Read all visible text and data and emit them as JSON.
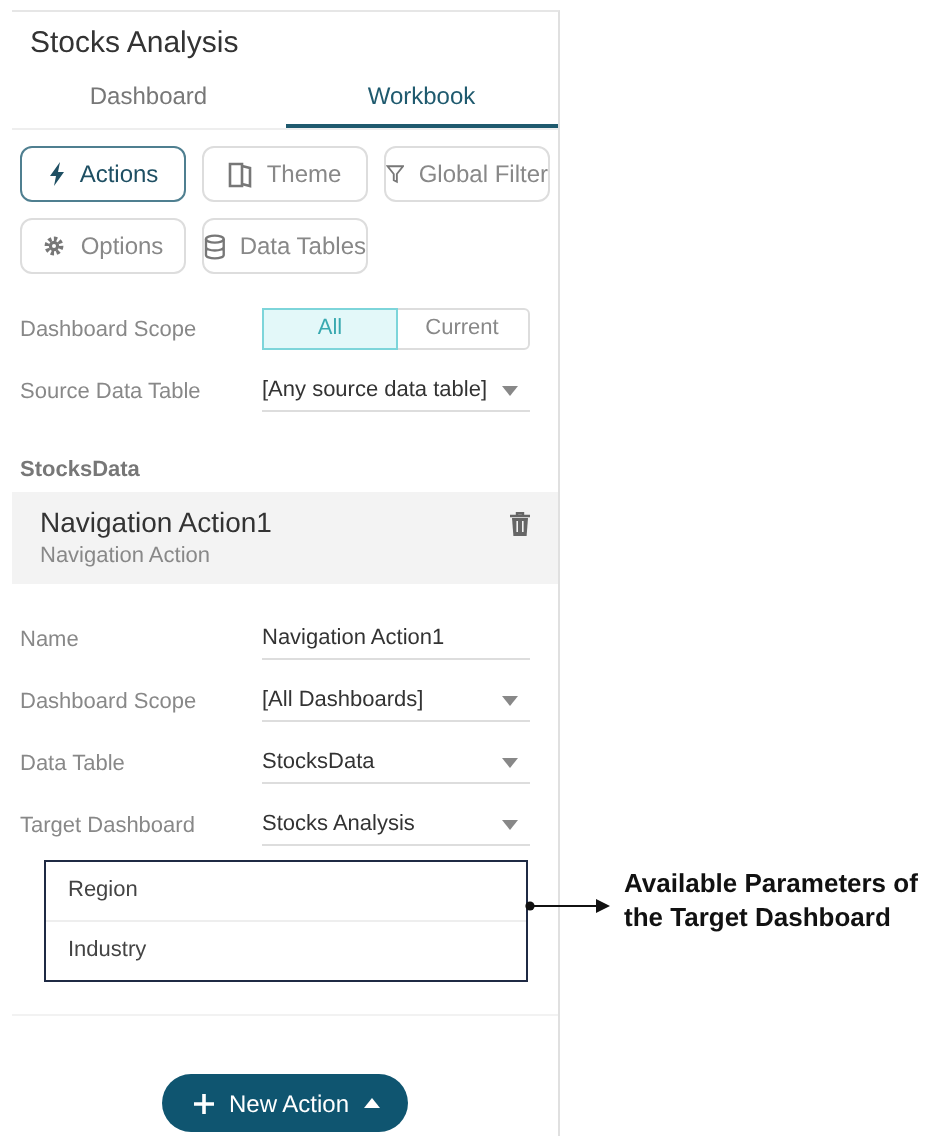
{
  "panel": {
    "title": "Stocks Analysis",
    "tabs": [
      {
        "label": "Dashboard",
        "selected": false
      },
      {
        "label": "Workbook",
        "selected": true
      }
    ],
    "tool_buttons": [
      {
        "label": "Actions",
        "selected": true
      },
      {
        "label": "Theme",
        "selected": false
      },
      {
        "label": "Global Filter",
        "selected": false
      },
      {
        "label": "Options",
        "selected": false
      },
      {
        "label": "Data Tables",
        "selected": false
      }
    ],
    "dashboard_scope": {
      "label": "Dashboard Scope",
      "options": [
        {
          "label": "All",
          "selected": true
        },
        {
          "label": "Current",
          "selected": false
        }
      ]
    },
    "source_data_table": {
      "label": "Source Data Table",
      "value": "[Any source data table]"
    },
    "section_title": "StocksData",
    "action": {
      "title": "Navigation Action1",
      "subtitle": "Navigation Action"
    },
    "fields": [
      {
        "label": "Name",
        "value": "Navigation Action1",
        "kind": "text"
      },
      {
        "label": "Dashboard Scope",
        "value": "[All Dashboards]",
        "kind": "dropdown"
      },
      {
        "label": "Data Table",
        "value": "StocksData",
        "kind": "dropdown"
      },
      {
        "label": "Target Dashboard",
        "value": "Stocks Analysis",
        "kind": "dropdown"
      }
    ],
    "parameters": [
      "Region",
      "Industry"
    ],
    "new_action_button": "New Action"
  },
  "annotation": {
    "text": "Available Parameters of the Target Dashboard"
  }
}
